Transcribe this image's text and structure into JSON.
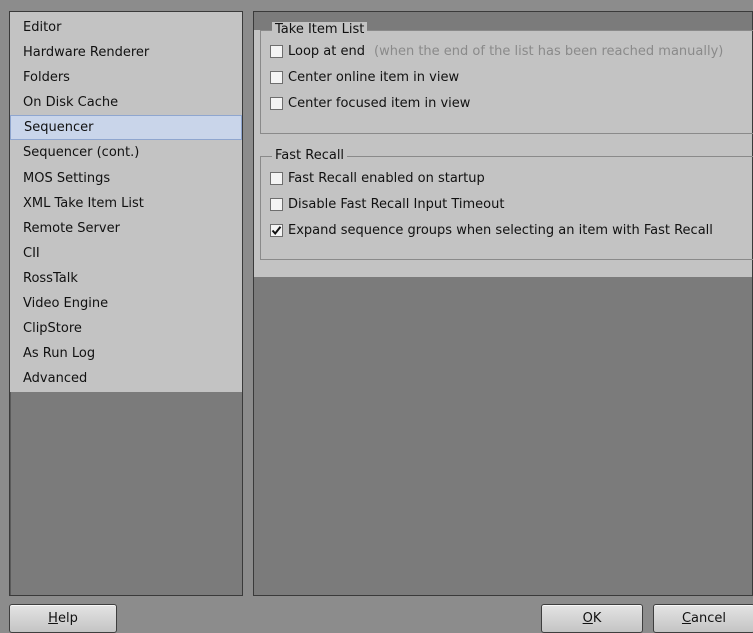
{
  "sidebar": {
    "items": [
      {
        "label": "Editor"
      },
      {
        "label": "Hardware Renderer"
      },
      {
        "label": "Folders"
      },
      {
        "label": "On Disk Cache"
      },
      {
        "label": "Sequencer",
        "selected": true
      },
      {
        "label": "Sequencer (cont.)"
      },
      {
        "label": "MOS Settings"
      },
      {
        "label": "XML Take Item List"
      },
      {
        "label": "Remote Server"
      },
      {
        "label": "CII"
      },
      {
        "label": "RossTalk"
      },
      {
        "label": "Video Engine"
      },
      {
        "label": "ClipStore"
      },
      {
        "label": "As Run Log"
      },
      {
        "label": "Advanced"
      }
    ]
  },
  "take_item_list": {
    "title": "Take Item List",
    "loop_at_end": {
      "label": "Loop at end",
      "hint": "(when the end of the list has been reached manually)",
      "checked": false
    },
    "center_online": {
      "label": "Center online item in view",
      "checked": false
    },
    "center_focused": {
      "label": "Center focused item in view",
      "checked": false
    }
  },
  "fast_recall": {
    "title": "Fast Recall",
    "enabled_on_startup": {
      "label": "Fast Recall enabled on startup",
      "checked": false
    },
    "disable_input_timeout": {
      "label": "Disable Fast Recall Input Timeout",
      "checked": false
    },
    "expand_groups": {
      "label": "Expand sequence groups when selecting an item with Fast Recall",
      "checked": true
    }
  },
  "buttons": {
    "help": {
      "mnemonic": "H",
      "rest": "elp"
    },
    "ok": {
      "mnemonic": "O",
      "rest": "K"
    },
    "cancel": {
      "mnemonic": "C",
      "rest": "ancel"
    }
  },
  "colors": {
    "selection_bg": "#c9d5ea",
    "panel_bg": "#c3c3c3",
    "window_bg": "#8c8c8c"
  }
}
